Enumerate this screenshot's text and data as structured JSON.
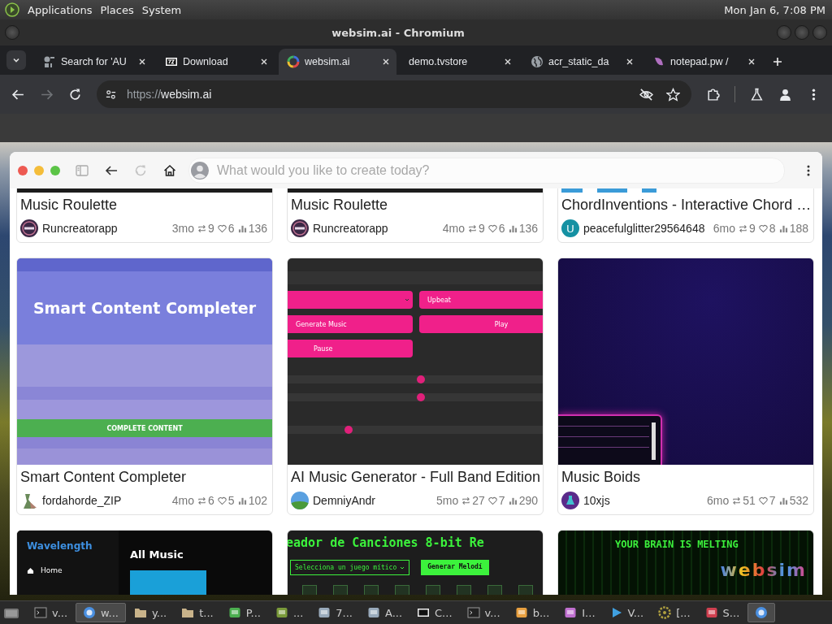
{
  "panel": {
    "menus": [
      "Applications",
      "Places",
      "System"
    ],
    "clock": "Mon Jan  6, 7:08 PM"
  },
  "window": {
    "title": "websim.ai - Chromium"
  },
  "tabs": [
    {
      "title": "Search for 'AU",
      "kind": "search",
      "selected": false
    },
    {
      "title": "Download",
      "kind": "archive",
      "selected": false
    },
    {
      "title": "websim.ai",
      "kind": "rainbow",
      "selected": true
    },
    {
      "title": "demo.tvstore",
      "kind": "blank",
      "selected": false
    },
    {
      "title": "acr_static_da",
      "kind": "globe",
      "selected": false
    },
    {
      "title": "notepad.pw /",
      "kind": "leaf",
      "selected": false
    }
  ],
  "toolbar": {
    "url_scheme": "https://",
    "url_host": "websim.ai",
    "forward_disabled": true
  },
  "websim": {
    "placeholder": "What would you like to create today?",
    "reload_disabled": true
  },
  "cards": [
    {
      "thumbnail": {
        "kind": "dark"
      },
      "title": "Music Roulette",
      "author": "Runcreatorapp",
      "avatar": {
        "kind": "axa"
      },
      "age": "3mo",
      "remixes": "9",
      "likes": "6",
      "views": "136"
    },
    {
      "thumbnail": {
        "kind": "dark"
      },
      "title": "Music Roulette",
      "author": "Runcreatorapp",
      "avatar": {
        "kind": "axa"
      },
      "age": "4mo",
      "remixes": "9",
      "likes": "6",
      "views": "136"
    },
    {
      "thumbnail": {
        "kind": "chord"
      },
      "title": "ChordInventions - Interactive Chord …",
      "author": "peacefulglitter29564648",
      "avatar": {
        "kind": "letter",
        "letter": "U",
        "color": "#1591a3"
      },
      "age": "6mo",
      "remixes": "9",
      "likes": "8",
      "views": "188"
    },
    {
      "thumbnail": {
        "kind": "smart",
        "heading": "Smart Content Completer",
        "button": "COMPLETE CONTENT"
      },
      "title": "Smart Content Completer",
      "author": "fordahorde_ZIP",
      "avatar": {
        "kind": "figure"
      },
      "age": "4mo",
      "remixes": "6",
      "likes": "5",
      "views": "102"
    },
    {
      "thumbnail": {
        "kind": "music-gen",
        "style": "Upbeat",
        "generate": "Generate Music",
        "play": "Play",
        "pause": "Pause",
        "sliders": [
          {
            "level": 0.52
          },
          {
            "level": 0.52
          },
          {
            "level": 0.23
          }
        ]
      },
      "title": "AI Music Generator - Full Band Edition",
      "author": "DemniyAndr",
      "avatar": {
        "kind": "landscape"
      },
      "age": "5mo",
      "remixes": "27",
      "likes": "7",
      "views": "290"
    },
    {
      "thumbnail": {
        "kind": "boids"
      },
      "title": "Music Boids",
      "author": "10xjs",
      "avatar": {
        "kind": "flask"
      },
      "age": "6mo",
      "remixes": "51",
      "likes": "7",
      "views": "532"
    },
    {
      "thumbnail": {
        "kind": "wavelength",
        "brand": "Wavelength",
        "nav": "Home",
        "heading": "All Music"
      }
    },
    {
      "thumbnail": {
        "kind": "canciones",
        "heading": "eador de Canciones 8-bit Re",
        "select": "Selecciona un juego mítico",
        "button": "Generar Melodí"
      }
    },
    {
      "thumbnail": {
        "kind": "matrix",
        "headline": "YOUR BRAIN IS MELTING",
        "logo": "websim"
      }
    }
  ],
  "taskbar": [
    {
      "label": "v...",
      "kind": "terminal",
      "selected": false
    },
    {
      "label": "w...",
      "kind": "browser",
      "selected": true
    },
    {
      "label": "y...",
      "kind": "folder",
      "selected": false
    },
    {
      "label": "t...",
      "kind": "folder",
      "selected": false
    },
    {
      "label": "P...",
      "kind": "green",
      "selected": false
    },
    {
      "label": "...",
      "kind": "cube",
      "selected": false
    },
    {
      "label": "7...",
      "kind": "printer",
      "selected": false
    },
    {
      "label": "A...",
      "kind": "printer",
      "selected": false
    },
    {
      "label": "C...",
      "kind": "archive",
      "selected": false
    },
    {
      "label": "v...",
      "kind": "terminal",
      "selected": false
    },
    {
      "label": "b...",
      "kind": "notepad",
      "selected": false
    },
    {
      "label": "I...",
      "kind": "image",
      "selected": false
    },
    {
      "label": "V...",
      "kind": "play",
      "selected": false
    },
    {
      "label": "[...",
      "kind": "gear",
      "selected": false
    },
    {
      "label": "S...",
      "kind": "bag",
      "selected": false
    },
    {
      "kind": "browser",
      "selected": true
    }
  ]
}
